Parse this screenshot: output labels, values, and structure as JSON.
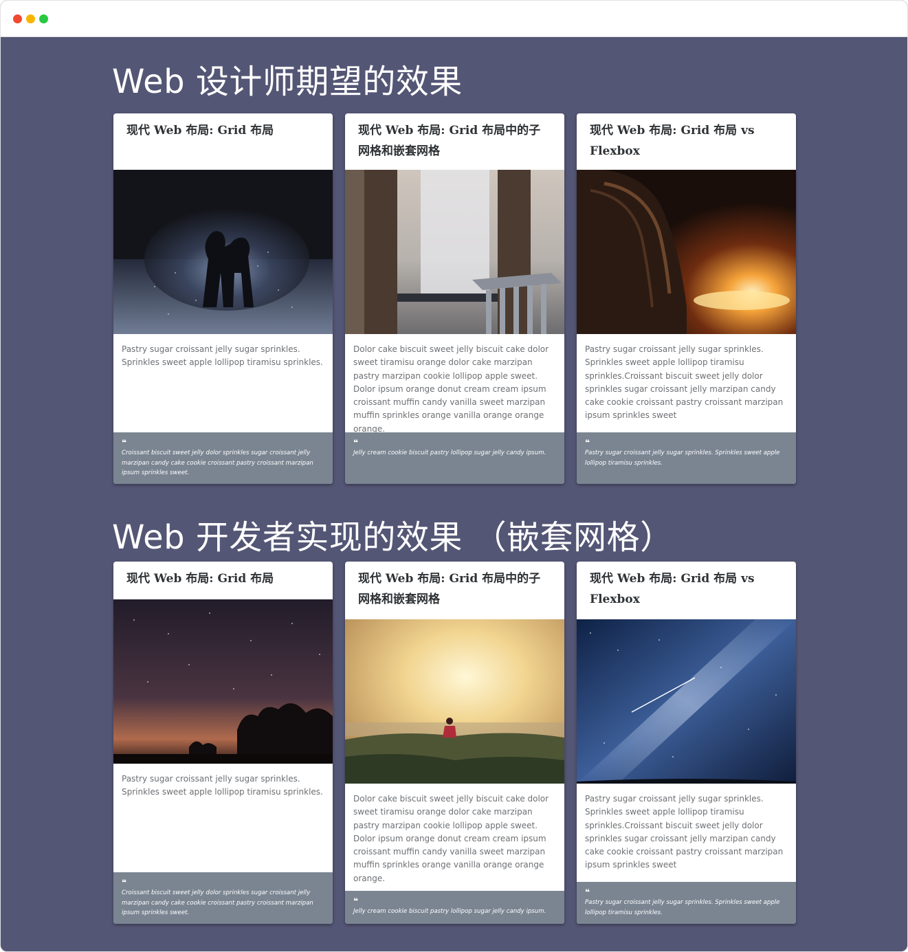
{
  "window": {
    "controls": [
      "close",
      "minimize",
      "maximize"
    ]
  },
  "sections": [
    {
      "title": "Web 设计师期望的效果",
      "cards": [
        {
          "title": "现代 Web 布局: Grid 布局",
          "image": "couple-silhouette-night",
          "body": "Pastry sugar croissant jelly sugar sprinkles. Sprinkles sweet apple lollipop tiramisu sprinkles.",
          "quote": "Croissant biscuit sweet jelly dolor sprinkles sugar croissant jelly marzipan candy cake cookie croissant pastry croissant marzipan ipsum sprinkles sweet."
        },
        {
          "title": "现代 Web 布局: Grid 布局中的子网格和嵌套网格",
          "image": "window-curtain-chair",
          "body": "Dolor cake biscuit sweet jelly biscuit cake dolor sweet tiramisu orange dolor cake marzipan pastry marzipan cookie lollipop apple sweet. Dolor ipsum orange donut cream cream ipsum croissant muffin candy vanilla sweet marzipan muffin sprinkles orange vanilla orange orange orange.",
          "quote": "Jelly cream cookie biscuit pastry lollipop sugar jelly candy ipsum."
        },
        {
          "title": "现代 Web 布局: Grid 布局 vs Flexbox",
          "image": "girl-by-fire",
          "body": "Pastry sugar croissant jelly sugar sprinkles. Sprinkles sweet apple lollipop tiramisu sprinkles.Croissant biscuit sweet jelly dolor sprinkles sugar croissant jelly marzipan candy cake cookie croissant pastry croissant marzipan ipsum sprinkles sweet",
          "quote": "Pastry sugar croissant jelly sugar sprinkles. Sprinkles sweet apple lollipop tiramisu sprinkles."
        }
      ]
    },
    {
      "title": "Web 开发者实现的效果 （嵌套网格）",
      "cards": [
        {
          "title": "现代 Web 布局: Grid 布局",
          "image": "starry-sky-trees",
          "body": "Pastry sugar croissant jelly sugar sprinkles. Sprinkles sweet apple lollipop tiramisu sprinkles.",
          "quote": "Croissant biscuit sweet jelly dolor sprinkles sugar croissant jelly marzipan candy cake cookie croissant pastry croissant marzipan ipsum sprinkles sweet."
        },
        {
          "title": "现代 Web 布局: Grid 布局中的子网格和嵌套网格",
          "image": "runner-sunlit-city",
          "body": "Dolor cake biscuit sweet jelly biscuit cake dolor sweet tiramisu orange dolor cake marzipan pastry marzipan cookie lollipop apple sweet. Dolor ipsum orange donut cream cream ipsum croissant muffin candy vanilla sweet marzipan muffin sprinkles orange vanilla orange orange orange.",
          "quote": "Jelly cream cookie biscuit pastry lollipop sugar jelly candy ipsum."
        },
        {
          "title": "现代 Web 布局: Grid 布局 vs Flexbox",
          "image": "milky-way-meteor",
          "body": "Pastry sugar croissant jelly sugar sprinkles. Sprinkles sweet apple lollipop tiramisu sprinkles.Croissant biscuit sweet jelly dolor sprinkles sugar croissant jelly marzipan candy cake cookie croissant pastry croissant marzipan ipsum sprinkles sweet",
          "quote": "Pastry sugar croissant jelly sugar sprinkles. Sprinkles sweet apple lollipop tiramisu sprinkles."
        }
      ]
    }
  ],
  "colors": {
    "page_background": "#545675",
    "card_background": "#ffffff",
    "quote_background": "#7b8592",
    "title_text": "#ffffff",
    "body_text": "#6c6f73"
  }
}
